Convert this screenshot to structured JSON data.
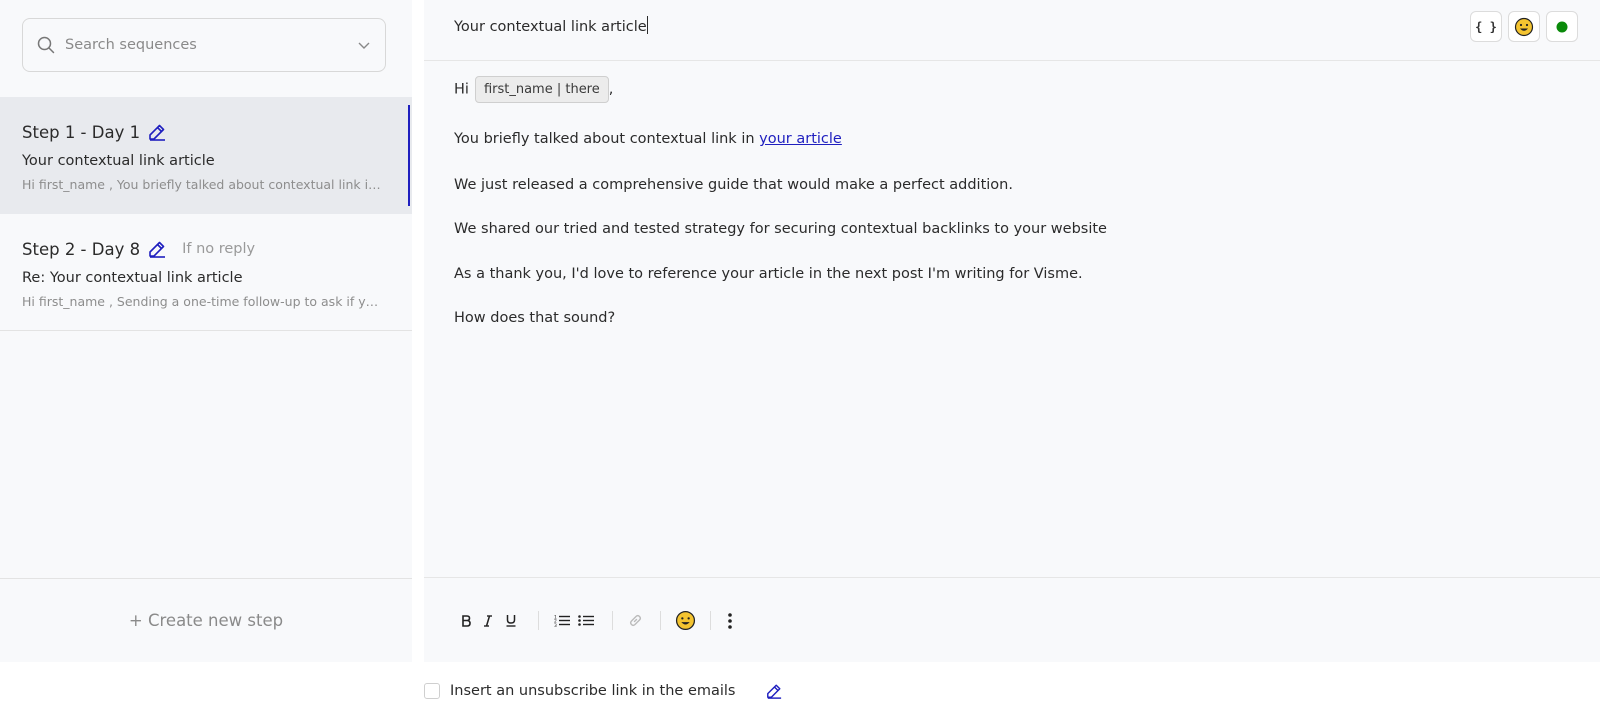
{
  "sidebar": {
    "search_placeholder": "Search sequences",
    "steps": [
      {
        "title": "Step 1 - Day 1",
        "condition": "",
        "subject": "Your contextual link article",
        "preview": "Hi first_name , You briefly talked about contextual link in your article We just released a comprehensive guide",
        "active": true
      },
      {
        "title": "Step 2 - Day 8",
        "condition": "If no reply",
        "subject": "Re: Your contextual link article",
        "preview": "Hi first_name , Sending a one-time follow-up to ask if you're interested in referencing our guide",
        "active": false
      }
    ],
    "create_step_label": "+ Create new step"
  },
  "editor": {
    "subject": "Your contextual link article",
    "top_tools": {
      "variables_label": "{ }",
      "emoji_icon": "smiley-face-icon",
      "status_color": "#0a8a0a"
    },
    "body": {
      "greeting": "Hi",
      "variable_chip": "first_name | there",
      "greeting_end": ",",
      "line2_text": "You briefly talked about contextual link in ",
      "line2_link": "your article",
      "line3": "We just released a comprehensive guide that would make a perfect addition.",
      "line4": "We shared our tried and tested strategy for securing contextual backlinks to your website",
      "line5": "As a thank you, I'd love to reference your article in the next post I'm writing for Visme.",
      "line6": "How does that sound?"
    },
    "toolbar": [
      "bold-icon",
      "italic-icon",
      "underline-icon",
      "ordered-list-icon",
      "bullet-list-icon",
      "link-icon",
      "emoji-icon",
      "more-options-icon"
    ]
  },
  "footer": {
    "unsubscribe_label": "Insert an unsubscribe link in the emails",
    "unsubscribe_checked": false
  },
  "colors": {
    "accent": "#1f1fbf",
    "status_green": "#0a8a0a",
    "emoji_yellow": "#f4c430"
  }
}
